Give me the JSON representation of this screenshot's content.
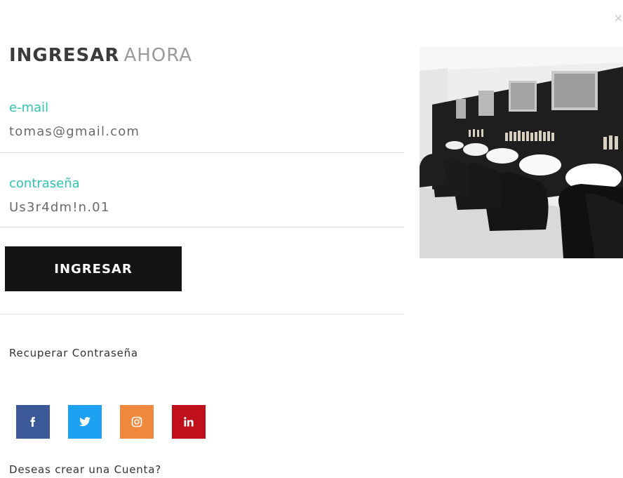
{
  "modal": {
    "close_symbol": "×",
    "title_strong": "INGRESAR",
    "title_light": "AHORA"
  },
  "form": {
    "email_label": "e-mail",
    "email_value": "tomas@gmail.com",
    "password_label": "contraseña",
    "password_value": "Us3r4dm!n.01",
    "submit_label": "INGRESAR"
  },
  "links": {
    "recover_password": "Recuperar Contraseña",
    "create_account": "Deseas crear una Cuenta?"
  },
  "social": [
    {
      "name": "facebook",
      "icon": "facebook-icon",
      "color": "#3b5998"
    },
    {
      "name": "twitter",
      "icon": "twitter-icon",
      "color": "#1da1f2"
    },
    {
      "name": "instagram",
      "icon": "instagram-icon",
      "color": "#f0883e"
    },
    {
      "name": "linkedin",
      "icon": "linkedin-icon",
      "color": "#c0101c"
    }
  ],
  "colors": {
    "accent": "#2ec5b3",
    "button": "#141414"
  }
}
